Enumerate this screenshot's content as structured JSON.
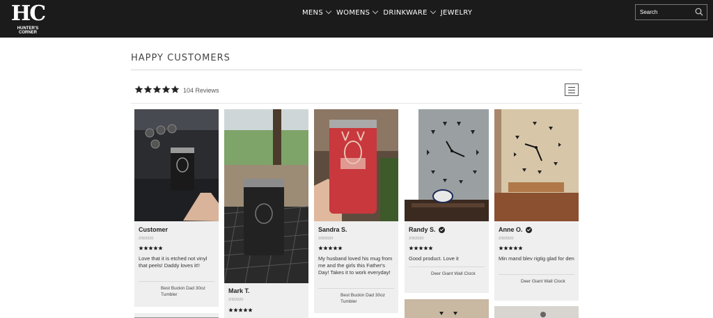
{
  "header": {
    "logo_mark": "HC",
    "logo_text": "HUNTER'S CORNER",
    "nav": [
      {
        "label": "MENS",
        "has_dropdown": true
      },
      {
        "label": "WOMENS",
        "has_dropdown": true
      },
      {
        "label": "DRINKWARE",
        "has_dropdown": true
      },
      {
        "label": "JEWELRY",
        "has_dropdown": false
      }
    ],
    "search_placeholder": "Search",
    "search_icon": "search-icon"
  },
  "main": {
    "title": "HAPPY CUSTOMERS",
    "rating": 5,
    "review_count": "104 Reviews",
    "reviews": [
      {
        "name": "Customer",
        "verified": false,
        "date": "2/9/2020",
        "rating": 5,
        "text": "Love that it is etched not vinyl that peels! Daddy loves it!!",
        "product": "Best Buckin Dad 30oz Tumbler",
        "image": "photo of black tumbler held in truck cab"
      },
      {
        "name": "Mark T.",
        "verified": false,
        "date": "2/9/2020",
        "rating": 5,
        "text": "",
        "product": "",
        "image": "photo of black tumbler on patio table"
      },
      {
        "name": "Sandra S.",
        "verified": false,
        "date": "2/9/2020",
        "rating": 5,
        "text": "My husband loved his mug from me and the girls this Father's Day! Takes it to work everyday!",
        "product": "Best Buckin Dad 30oz Tumbler",
        "image": "photo of red deer tumbler"
      },
      {
        "name": "Randy S.",
        "verified": true,
        "date": "2/9/2020",
        "rating": 5,
        "text": "Good product. Love it",
        "product": "Deer Giant Wall Clock",
        "image": "photo of deer wall clock"
      },
      {
        "name": "Anne O.",
        "verified": true,
        "date": "2/9/2020",
        "rating": 5,
        "text": "Min mand blev rigtig glad for den",
        "product": "Deer Giant Wall Clock",
        "image": "photo of deer wall clock on beige wall"
      }
    ]
  },
  "colors": {
    "header_bg": "#1b1b1b",
    "card_bg": "#efefef",
    "star": "#222222"
  }
}
